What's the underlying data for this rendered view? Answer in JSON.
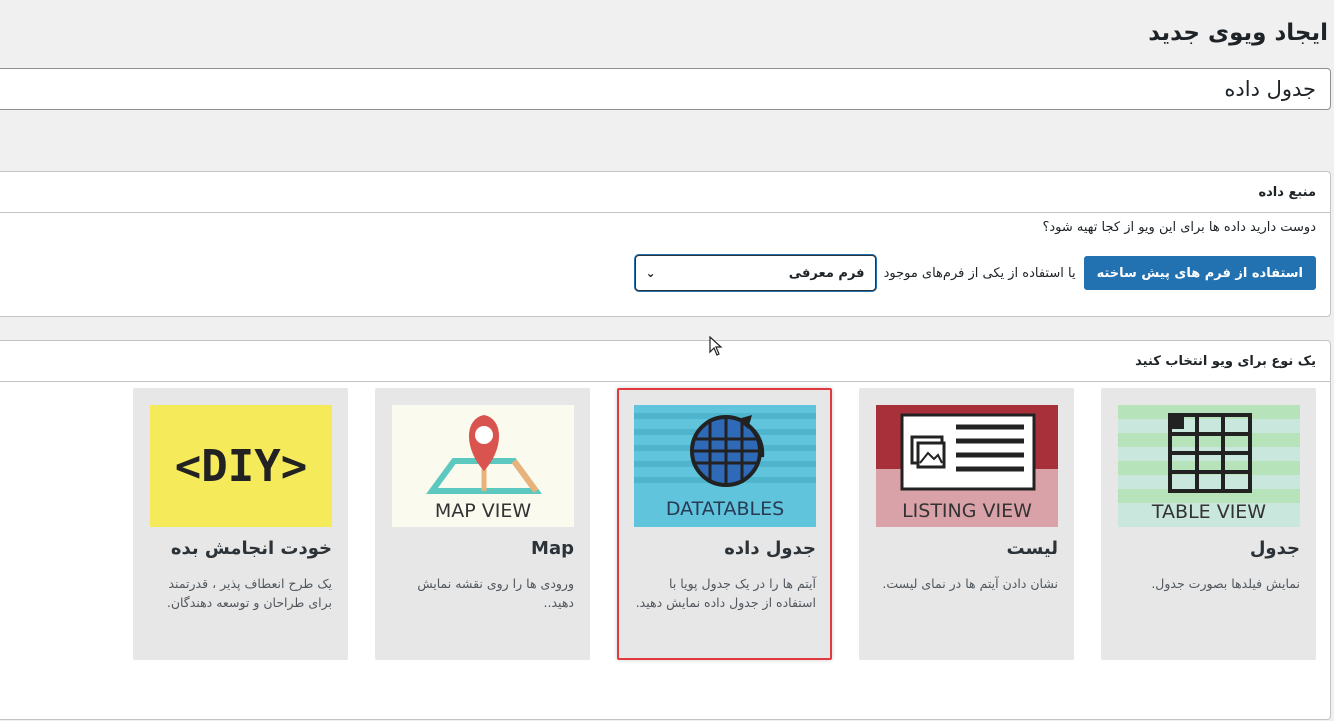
{
  "page": {
    "title": "ایجاد ویوی جدید"
  },
  "title_input": {
    "value": "جدول داده"
  },
  "data_source": {
    "header": "منبع داده",
    "question": "دوست دارید داده ها برای این ویو از کجا تهیه شود؟",
    "prebuilt_button": "استفاده از فرم های پیش ساخته",
    "or_text": "یا استفاده از یکی از فرم‌های موجود",
    "form_select": {
      "value": "فرم معرفی"
    }
  },
  "view_type": {
    "header": "یک نوع برای ویو انتخاب کنید",
    "cards": [
      {
        "title": "جدول",
        "desc": "نمایش فیلدها بصورت جدول.",
        "thumb_label": "TABLE VIEW",
        "icon": "table-icon",
        "selected": false
      },
      {
        "title": "لیست",
        "desc": "نشان دادن آیتم ها در نمای لیست.",
        "thumb_label": "LISTING VIEW",
        "icon": "listing-icon",
        "selected": false
      },
      {
        "title": "جدول داده",
        "desc": "آیتم ها را در یک جدول پویا با استفاده از جدول داده نمایش دهید.",
        "thumb_label": "DATATABLES",
        "icon": "globe-grid-icon",
        "selected": true
      },
      {
        "title": "Map",
        "desc": "ورودی ها را روی نقشه نمایش دهید..",
        "thumb_label": "MAP VIEW",
        "icon": "map-pin-icon",
        "selected": false
      },
      {
        "title": "خودت انجامش بده",
        "desc": "یک طرح انعطاف پذیر ، قدرتمند برای طراحان و توسعه دهندگان.",
        "thumb_label": "<DIY>",
        "icon": "diy-icon",
        "selected": false
      }
    ]
  },
  "colors": {
    "primary": "#2271b1",
    "selected_border": "#e0393e",
    "diy_yellow": "#f5eb5a",
    "datatables_blue": "#5fc4dc",
    "listing_red": "#a8303a"
  }
}
